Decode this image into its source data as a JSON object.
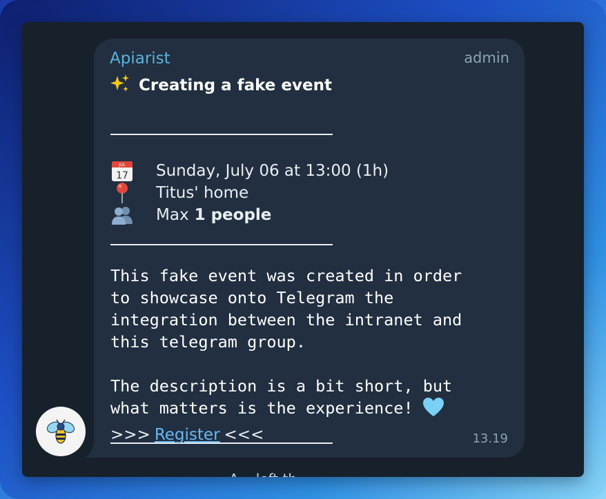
{
  "message": {
    "sender": "Apiarist",
    "role": "admin",
    "title": "Creating a fake event",
    "date": "Sunday, July 06 at 13:00 (1h)",
    "location": "Titus' home",
    "capacity_prefix": "Max",
    "capacity_value": "1 people",
    "description_1": "This fake event was created in order\nto showcase onto Telegram the\nintegration between the intranet and\nthis telegram group.",
    "description_2": "The description is a bit short, but\nwhat matters is the experience!",
    "register_prefix": ">>>",
    "register_label": "Register",
    "register_suffix": "<<<",
    "time": "13.19",
    "peek_text": "A... left th..."
  },
  "icons": {
    "sparkles": "sparkles-icon",
    "calendar": "calendar-icon",
    "pin": "pin-icon",
    "people": "people-icon",
    "heart": "blue-heart-icon",
    "avatar": "bee-avatar"
  },
  "colors": {
    "bubble": "#212f40",
    "window": "#17212b",
    "sender": "#5bb3d9",
    "link": "#6ab7f2"
  }
}
